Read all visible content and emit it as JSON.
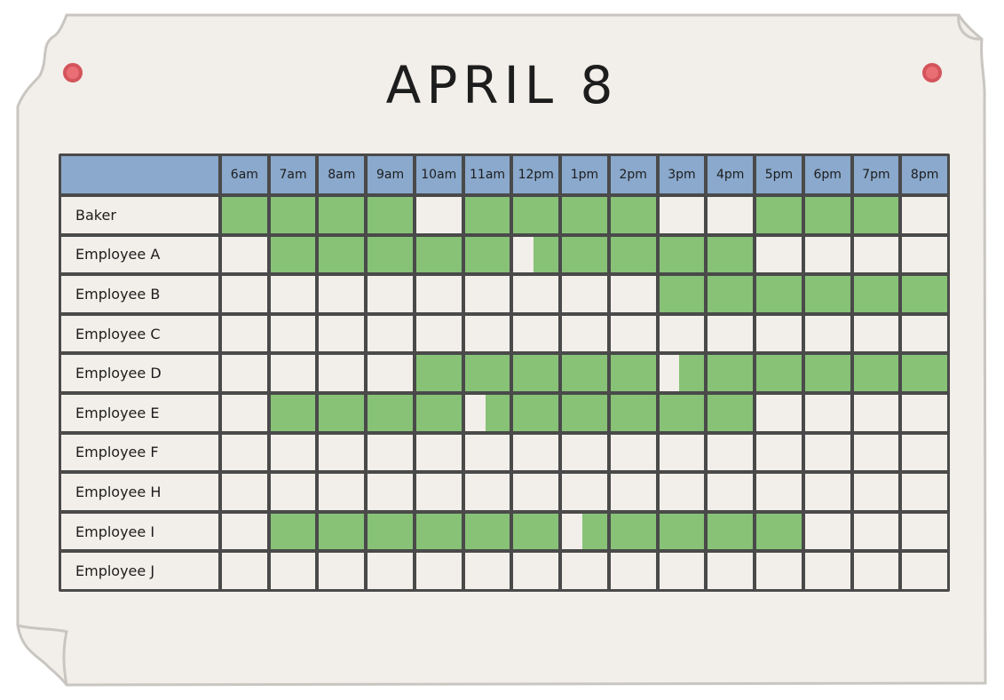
{
  "title": "APRIL 8",
  "colors": {
    "paper": "#f2eee9",
    "header": "#8aa9cc",
    "shift": "#87c277",
    "grid": "#4a4a4a",
    "pin": "#ea6f75"
  },
  "hours": [
    "6am",
    "7am",
    "8am",
    "9am",
    "10am",
    "11am",
    "12pm",
    "1pm",
    "2pm",
    "3pm",
    "4pm",
    "5pm",
    "6pm",
    "7pm",
    "8pm"
  ],
  "rows": [
    {
      "name": "Baker",
      "shifts": [
        1,
        1,
        1,
        1,
        0,
        1,
        1,
        1,
        1,
        0,
        0,
        1,
        1,
        1,
        0
      ]
    },
    {
      "name": "Employee A",
      "shifts": [
        0,
        1,
        1,
        1,
        1,
        1,
        0.55,
        1,
        1,
        1,
        1,
        0,
        0,
        0,
        0
      ]
    },
    {
      "name": "Employee B",
      "shifts": [
        0,
        0,
        0,
        0,
        0,
        0,
        0,
        0,
        0,
        1,
        1,
        1,
        1,
        1,
        1
      ]
    },
    {
      "name": "Employee C",
      "shifts": [
        0,
        0,
        0,
        0,
        0,
        0,
        0,
        0,
        0,
        0,
        0,
        0,
        0,
        0,
        0
      ]
    },
    {
      "name": "Employee D",
      "shifts": [
        0,
        0,
        0,
        0,
        1,
        1,
        1,
        1,
        1,
        0.55,
        1,
        1,
        1,
        1,
        1
      ]
    },
    {
      "name": "Employee E",
      "shifts": [
        0,
        1,
        1,
        1,
        1,
        0.55,
        1,
        1,
        1,
        1,
        1,
        0,
        0,
        0,
        0
      ]
    },
    {
      "name": "Employee F",
      "shifts": [
        0,
        0,
        0,
        0,
        0,
        0,
        0,
        0,
        0,
        0,
        0,
        0,
        0,
        0,
        0
      ]
    },
    {
      "name": "Employee H",
      "shifts": [
        0,
        0,
        0,
        0,
        0,
        0,
        0,
        0,
        0,
        0,
        0,
        0,
        0,
        0,
        0
      ]
    },
    {
      "name": "Employee I",
      "shifts": [
        0,
        1,
        1,
        1,
        1,
        1,
        1,
        0.55,
        1,
        1,
        1,
        1,
        0,
        0,
        0
      ]
    },
    {
      "name": "Employee J",
      "shifts": [
        0,
        0,
        0,
        0,
        0,
        0,
        0,
        0,
        0,
        0,
        0,
        0,
        0,
        0,
        0
      ]
    }
  ]
}
